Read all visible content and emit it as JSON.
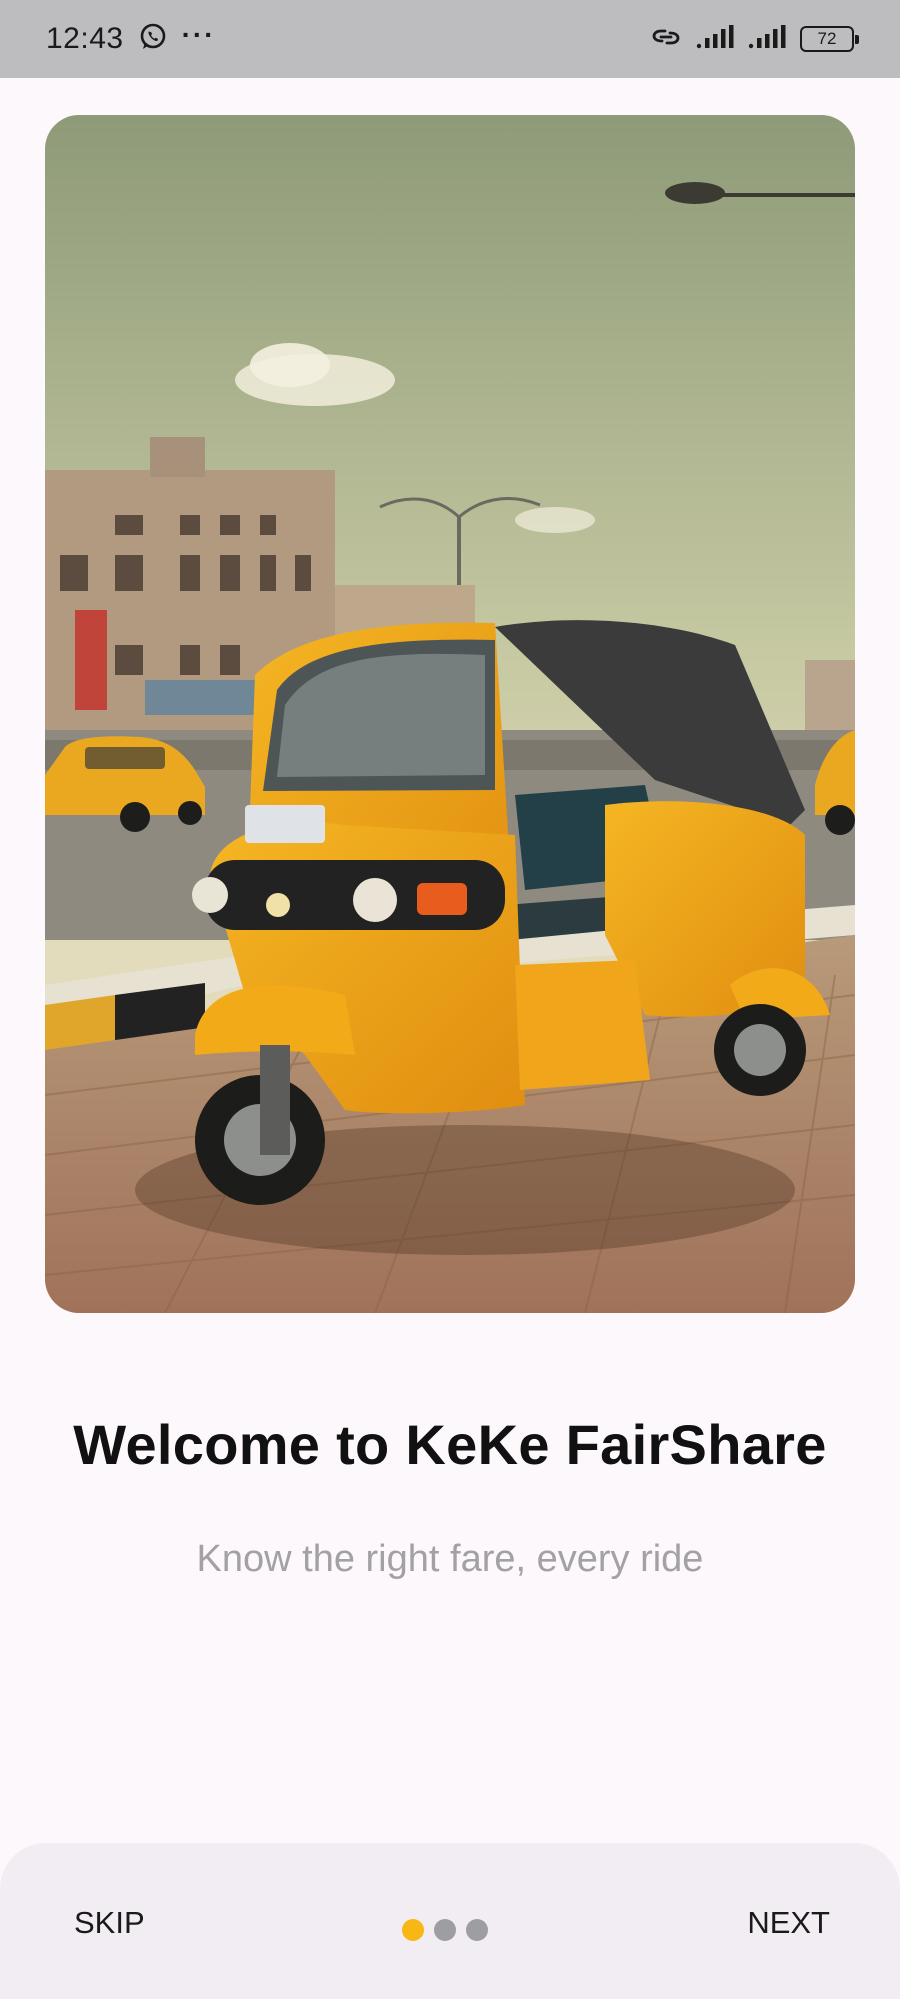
{
  "status_bar": {
    "time": "12:43",
    "notification_icons": [
      "whatsapp-icon",
      "more-dots-icon"
    ],
    "status_icons": [
      "link-icon",
      "signal-1-icon",
      "signal-2-icon"
    ],
    "battery_level": "72"
  },
  "onboarding": {
    "hero_image": "yellow-keke-tricycle-on-street",
    "title": "Welcome to KeKe FairShare",
    "subtitle": "Know the right fare, every ride",
    "page_count": 3,
    "current_page": 1,
    "accent_color": "#f7b715"
  },
  "navigation": {
    "skip_label": "SKIP",
    "next_label": "NEXT"
  }
}
